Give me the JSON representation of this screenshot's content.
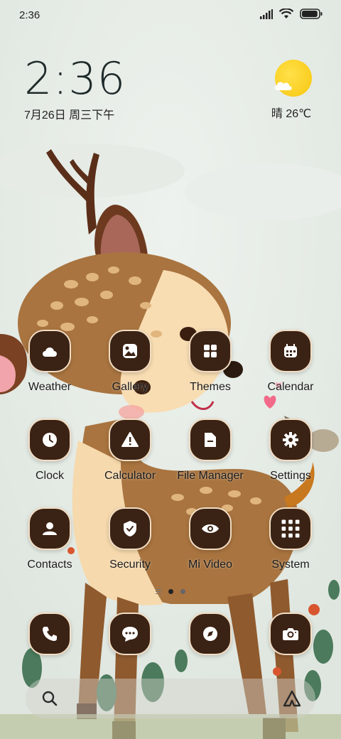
{
  "status_bar": {
    "time": "2:36",
    "battery_level": 0.95
  },
  "clock_widget": {
    "time": "2:36",
    "date": "7月26日 周三下午"
  },
  "weather_widget": {
    "condition_icon": "sun-cloud-icon",
    "text": "晴 26℃"
  },
  "apps": [
    {
      "label": "Weather",
      "icon": "weather-icon"
    },
    {
      "label": "Gallery",
      "icon": "gallery-icon"
    },
    {
      "label": "Themes",
      "icon": "themes-icon"
    },
    {
      "label": "Calendar",
      "icon": "calendar-icon"
    },
    {
      "label": "Clock",
      "icon": "clock-icon"
    },
    {
      "label": "Calculator",
      "icon": "warning-icon"
    },
    {
      "label": "File Manager",
      "icon": "folder-icon"
    },
    {
      "label": "Settings",
      "icon": "gear-icon"
    },
    {
      "label": "Contacts",
      "icon": "contact-icon"
    },
    {
      "label": "Security",
      "icon": "shield-icon"
    },
    {
      "label": "Mi Video",
      "icon": "eye-icon"
    },
    {
      "label": "System",
      "icon": "folder-grid-icon"
    }
  ],
  "page_indicator": {
    "pages": 2,
    "current": 1
  },
  "dock": [
    {
      "icon": "phone-icon"
    },
    {
      "icon": "message-icon"
    },
    {
      "icon": "browser-icon"
    },
    {
      "icon": "camera-icon"
    }
  ],
  "colors": {
    "icon_bg": "#3a2214",
    "icon_border": "#f2ddc3",
    "sun": "#f8c60e"
  }
}
